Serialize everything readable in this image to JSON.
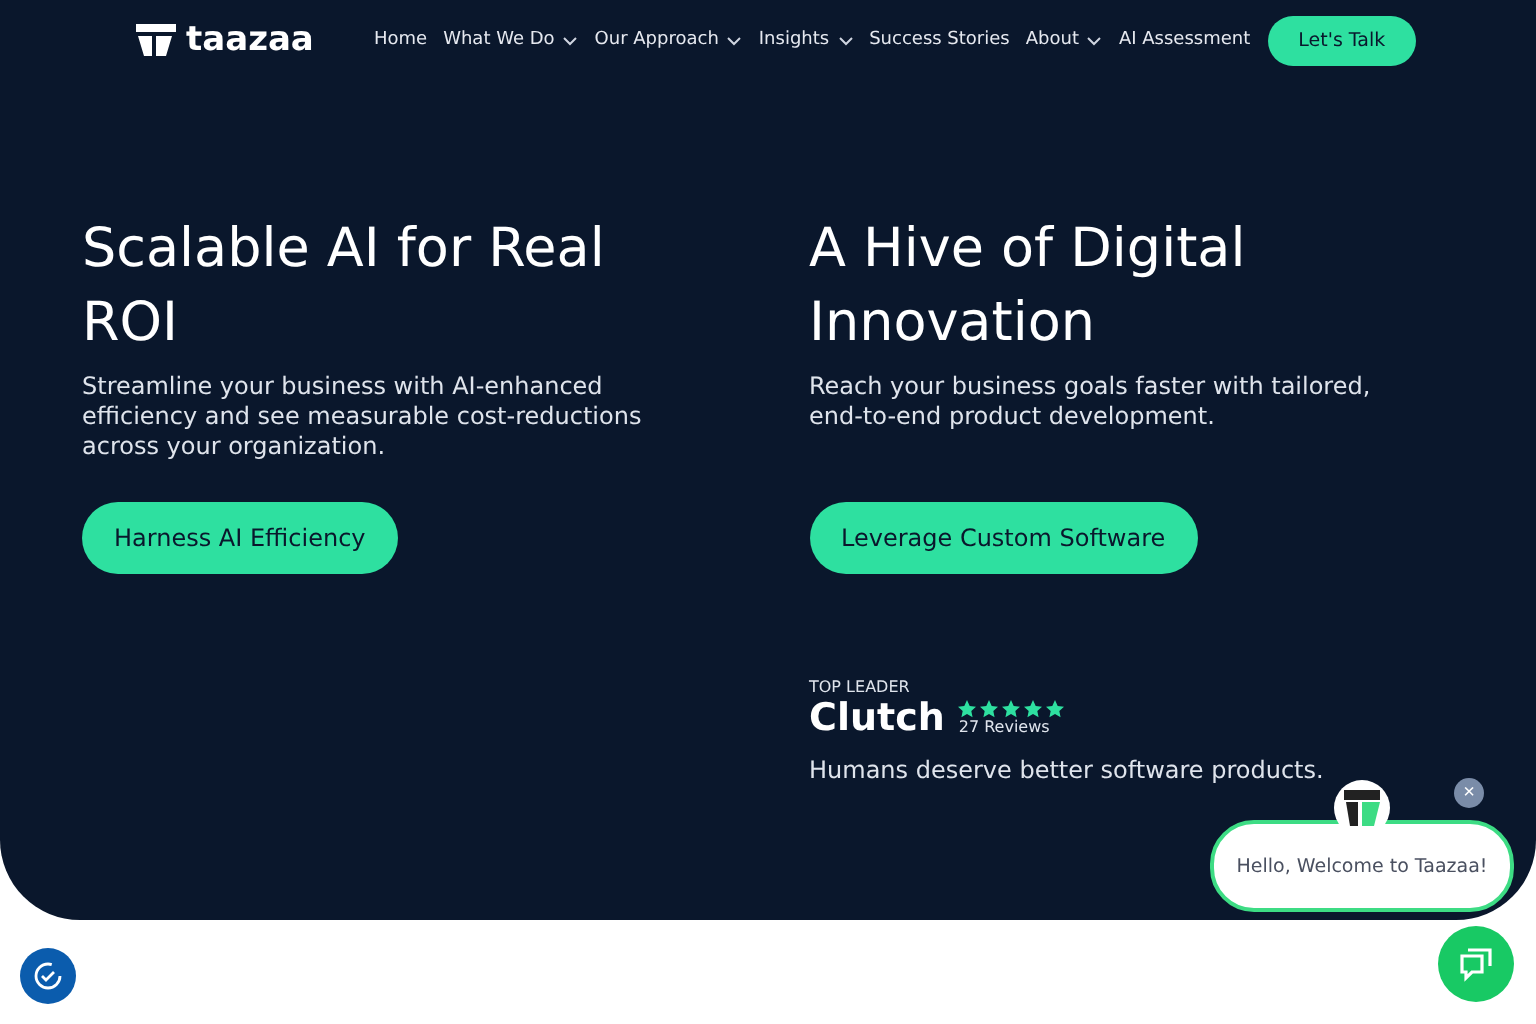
{
  "header": {
    "logo": "taazaa",
    "nav": [
      {
        "label": "Home",
        "dropdown": false
      },
      {
        "label": "What We Do",
        "dropdown": true
      },
      {
        "label": "Our Approach",
        "dropdown": true
      },
      {
        "label": "Insights",
        "dropdown": true
      },
      {
        "label": "Success Stories",
        "dropdown": false
      },
      {
        "label": "About",
        "dropdown": true
      },
      {
        "label": "AI Assessment",
        "dropdown": false
      }
    ],
    "cta": "Let's Talk"
  },
  "hero": [
    {
      "title": "Scalable AI for Real ROI",
      "text": "Streamline your business with AI-enhanced efficiency and see measurable cost-reductions across your organization.",
      "button": "Harness AI Efficiency"
    },
    {
      "title": "A Hive of Digital Innovation",
      "text": "Reach your business goals faster with tailored, end-to-end product development.",
      "button": "Leverage Custom Software"
    }
  ],
  "rating": {
    "badge": "TOP LEADER",
    "brand": "Clutch",
    "stars": 5,
    "reviews": "27 Reviews",
    "tagline": "Humans deserve better software products."
  },
  "chat": {
    "greeting": "Hello, Welcome to Taazaa!",
    "close": "×"
  }
}
